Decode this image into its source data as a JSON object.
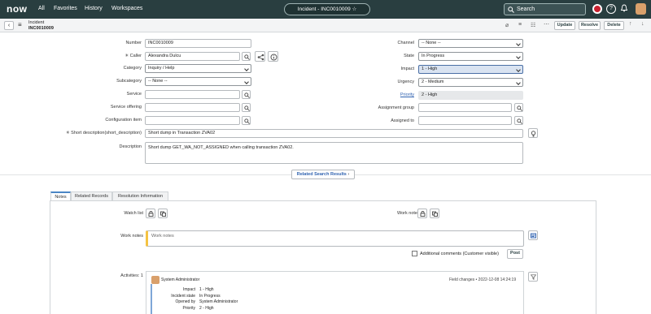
{
  "nav": {
    "logo": "now",
    "menu": [
      "All",
      "Favorites",
      "History",
      "Workspaces"
    ],
    "title_pill": "Incident - INC0010009",
    "search_placeholder": "Search"
  },
  "header": {
    "record_type": "Incident",
    "record_number": "INC0010009",
    "update_label": "Update",
    "resolve_label": "Resolve",
    "delete_label": "Delete"
  },
  "form": {
    "number_label": "Number",
    "number_value": "INC0010009",
    "caller_label": "Caller",
    "caller_value": "Alexandra Dulcu",
    "category_label": "Category",
    "category_value": "Inquiry / Help",
    "subcategory_label": "Subcategory",
    "subcategory_value": "-- None --",
    "service_label": "Service",
    "service_value": "",
    "service_offering_label": "Service offering",
    "service_offering_value": "",
    "config_item_label": "Configuration item",
    "config_item_value": "",
    "channel_label": "Channel",
    "channel_value": "-- None --",
    "state_label": "State",
    "state_value": "In Progress",
    "impact_label": "Impact",
    "impact_value": "1 - High",
    "urgency_label": "Urgency",
    "urgency_value": "2 - Medium",
    "priority_label": "Priority",
    "priority_value": "2 - High",
    "assignment_group_label": "Assignment group",
    "assignment_group_value": "",
    "assigned_to_label": "Assigned to",
    "assigned_to_value": "",
    "short_desc_label": "Short description(short_description)",
    "short_desc_value": "Short dump in Transaction ZVA02",
    "description_label": "Description",
    "description_value": "Short dump GET_WA_NOT_ASSIGNED when calling transaction ZVA02."
  },
  "related_search_label": "Related Search Results",
  "tabs": [
    "Notes",
    "Related Records",
    "Resolution Information"
  ],
  "notes": {
    "watch_list_label": "Watch list",
    "work_notes_list_label": "Work notes list",
    "work_notes_label": "Work notes",
    "work_notes_placeholder": "Work notes",
    "additional_comments_label": "Additional comments (Customer visible)",
    "post_label": "Post",
    "activities_label": "Activities: 1"
  },
  "activity": {
    "author": "System Administrator",
    "field_changes": "Field changes",
    "timestamp": "2022-12-08 14:24:19",
    "rows": [
      {
        "field": "Impact",
        "value": "1 - High"
      },
      {
        "field": "Incident state",
        "value": "In Progress"
      },
      {
        "field": "Opened by",
        "value": "System Administrator"
      },
      {
        "field": "Priority",
        "value": "2 - High"
      }
    ]
  },
  "colors": {
    "nav_bg": "#293e40",
    "accent": "#4a86c5",
    "impact_bg": "#d9e3f1",
    "work_notes_bar": "#f5c342"
  }
}
